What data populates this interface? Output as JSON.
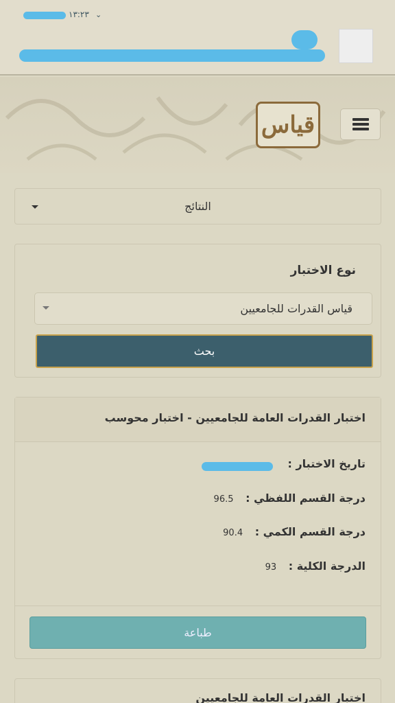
{
  "status_bar": {
    "time": "١٣:٢٣"
  },
  "header": {
    "logo_text": "قياس"
  },
  "results_dropdown": {
    "label": "النتائج"
  },
  "search_panel": {
    "title": "نوع الاختبار",
    "select_value": "قياس القدرات للجامعيين",
    "search_label": "بحث"
  },
  "result_card": {
    "title": "اختبار القدرات العامة للجامعيين - اختبار محوسب",
    "rows": [
      {
        "label": "تاريخ الاختبار :",
        "value": ""
      },
      {
        "label": "درجة القسم اللفظي :",
        "value": "96.5"
      },
      {
        "label": "درجة القسم الكمي :",
        "value": "90.4"
      },
      {
        "label": "الدرجة الكلية :",
        "value": "93"
      }
    ],
    "print_label": "طباعة"
  },
  "next_card": {
    "title": "اختبار القدرات العامة للجامعيين"
  },
  "colors": {
    "background": "#dcd8c4",
    "search_button": "#3c5f6c",
    "print_button": "#6fb0b0",
    "logo": "#8b6a3b"
  }
}
